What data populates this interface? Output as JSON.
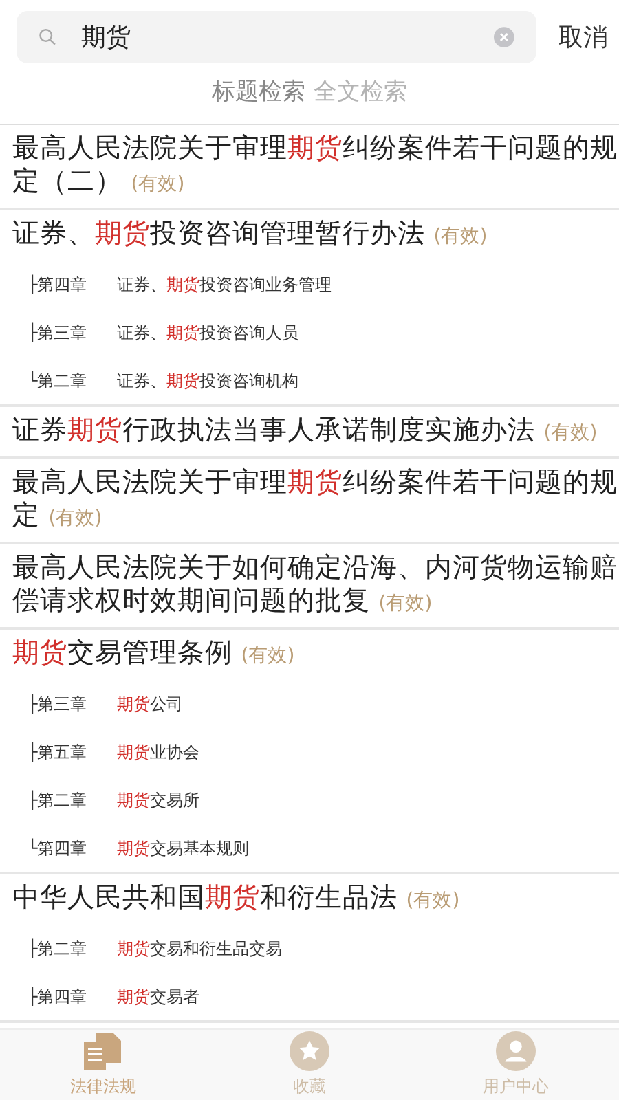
{
  "search": {
    "value": "期货",
    "cancel": "取消"
  },
  "search_modes": [
    {
      "label": "标题检索",
      "selected": true
    },
    {
      "label": "全文检索",
      "selected": false
    }
  ],
  "results": [
    {
      "title": [
        {
          "text": "最高人民法院关于审理",
          "hit": false
        },
        {
          "text": "期货",
          "hit": true
        },
        {
          "text": "纠纷案件若干问题的规定（二）",
          "hit": false
        }
      ],
      "status": "(有效)"
    },
    {
      "title": [
        {
          "text": "证券、",
          "hit": false
        },
        {
          "text": "期货",
          "hit": true
        },
        {
          "text": "投资咨询管理暂行办法",
          "hit": false
        }
      ],
      "status": "(有效)",
      "chapters": [
        {
          "branch": "├",
          "chapter": "第四章",
          "title": [
            {
              "text": "证券、",
              "hit": false
            },
            {
              "text": "期货",
              "hit": true
            },
            {
              "text": "投资咨询业务管理",
              "hit": false
            }
          ]
        },
        {
          "branch": "├",
          "chapter": "第三章",
          "title": [
            {
              "text": "证券、",
              "hit": false
            },
            {
              "text": "期货",
              "hit": true
            },
            {
              "text": "投资咨询人员",
              "hit": false
            }
          ]
        },
        {
          "branch": "└",
          "chapter": "第二章",
          "title": [
            {
              "text": "证券、",
              "hit": false
            },
            {
              "text": "期货",
              "hit": true
            },
            {
              "text": "投资咨询机构",
              "hit": false
            }
          ]
        }
      ]
    },
    {
      "title": [
        {
          "text": "证券",
          "hit": false
        },
        {
          "text": "期货",
          "hit": true
        },
        {
          "text": "行政执法当事人承诺制度实施办法",
          "hit": false
        }
      ],
      "status": "(有效)"
    },
    {
      "title": [
        {
          "text": "最高人民法院关于审理",
          "hit": false
        },
        {
          "text": "期货",
          "hit": true
        },
        {
          "text": "纠纷案件若干问题的规定",
          "hit": false
        }
      ],
      "status": "(有效)"
    },
    {
      "title": [
        {
          "text": "最高人民法院关于如何确定沿海、内河货物运输赔偿请求权时效期间问题的批复",
          "hit": false
        }
      ],
      "status": "(有效)"
    },
    {
      "title": [
        {
          "text": "期货",
          "hit": true
        },
        {
          "text": "交易管理条例",
          "hit": false
        }
      ],
      "status": "(有效)",
      "chapters": [
        {
          "branch": "├",
          "chapter": "第三章",
          "title": [
            {
              "text": "期货",
              "hit": true
            },
            {
              "text": "公司",
              "hit": false
            }
          ]
        },
        {
          "branch": "├",
          "chapter": "第五章",
          "title": [
            {
              "text": "期货",
              "hit": true
            },
            {
              "text": "业协会",
              "hit": false
            }
          ]
        },
        {
          "branch": "├",
          "chapter": "第二章",
          "title": [
            {
              "text": "期货",
              "hit": true
            },
            {
              "text": "交易所",
              "hit": false
            }
          ]
        },
        {
          "branch": "└",
          "chapter": "第四章",
          "title": [
            {
              "text": "期货",
              "hit": true
            },
            {
              "text": "交易基本规则",
              "hit": false
            }
          ]
        }
      ]
    },
    {
      "title": [
        {
          "text": "中华人民共和国",
          "hit": false
        },
        {
          "text": "期货",
          "hit": true
        },
        {
          "text": "和衍生品法",
          "hit": false
        }
      ],
      "status": "(有效)",
      "chapters": [
        {
          "branch": "├",
          "chapter": "第二章",
          "title": [
            {
              "text": "期货",
              "hit": true
            },
            {
              "text": "交易和衍生品交易",
              "hit": false
            }
          ]
        },
        {
          "branch": "├",
          "chapter": "第四章",
          "title": [
            {
              "text": "期货",
              "hit": true
            },
            {
              "text": "交易者",
              "hit": false
            }
          ]
        }
      ]
    }
  ],
  "bottom_nav": [
    {
      "kind": "laws",
      "label": "法律法规",
      "selected": true
    },
    {
      "kind": "favorites",
      "label": "收藏",
      "selected": false
    },
    {
      "kind": "user",
      "label": "用户中心",
      "selected": false
    }
  ]
}
